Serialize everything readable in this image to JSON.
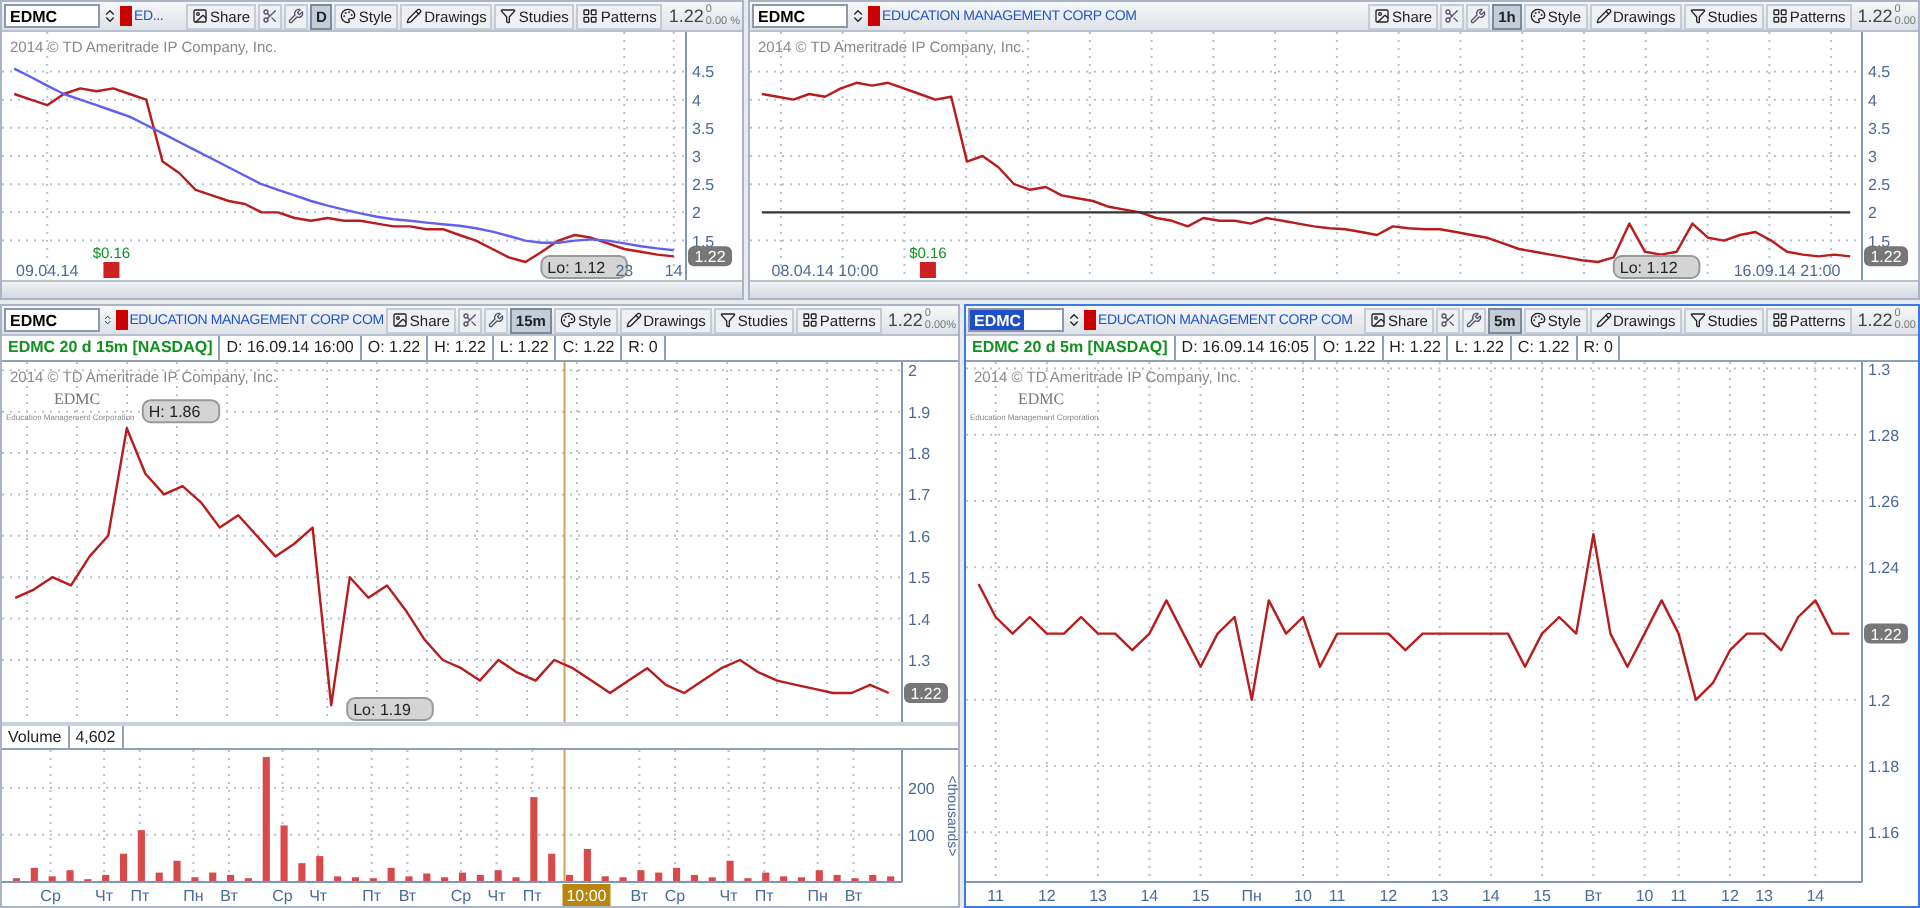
{
  "panels": [
    {
      "active": false,
      "symbol": {
        "value": "EDMC",
        "highlighted": false
      },
      "company": "ED...",
      "interval": "D",
      "price": "1.22",
      "change": "0",
      "change_pct": "0.00 %",
      "buttons": [
        "Share",
        "Style",
        "Drawings",
        "Studies",
        "Patterns"
      ],
      "copyright": "2014 © TD Ameritrade IP Company, Inc.",
      "dividend": "$0.16",
      "last_price_tag": "1.22",
      "chart_data": {
        "type": "line",
        "grid": true,
        "ylim": [
          0.8,
          5.2
        ],
        "yticks": [
          1.5,
          2,
          2.5,
          3,
          3.5,
          4,
          4.5
        ],
        "categories": [
          null,
          null,
          "09.04.14",
          null,
          null,
          null,
          null,
          null,
          null,
          null,
          null,
          null,
          null,
          null,
          null,
          null,
          null,
          null,
          null,
          null,
          null,
          null,
          null,
          null,
          null,
          null,
          null,
          null,
          null,
          null,
          null,
          null,
          null,
          null,
          null,
          null,
          null,
          "23",
          null,
          null,
          "14"
        ],
        "series": [
          {
            "color": "#b81c1c",
            "values": [
              4.1,
              4.0,
              3.9,
              4.1,
              4.2,
              4.15,
              4.2,
              4.1,
              4.0,
              2.9,
              2.7,
              2.4,
              2.3,
              2.2,
              2.15,
              2.0,
              2.0,
              1.9,
              1.85,
              1.9,
              1.85,
              1.85,
              1.8,
              1.75,
              1.75,
              1.7,
              1.7,
              1.6,
              1.5,
              1.35,
              1.2,
              1.12,
              1.3,
              1.5,
              1.6,
              1.55,
              1.45,
              1.35,
              1.3,
              1.25,
              1.22
            ]
          },
          {
            "color": "#6060f0",
            "values": [
              4.55,
              4.4,
              4.25,
              4.1,
              4.0,
              3.9,
              3.8,
              3.7,
              3.55,
              3.4,
              3.25,
              3.1,
              2.95,
              2.8,
              2.65,
              2.5,
              2.4,
              2.3,
              2.2,
              2.12,
              2.05,
              1.98,
              1.92,
              1.88,
              1.85,
              1.82,
              1.79,
              1.76,
              1.72,
              1.66,
              1.58,
              1.5,
              1.46,
              1.46,
              1.5,
              1.52,
              1.5,
              1.45,
              1.4,
              1.36,
              1.33
            ]
          }
        ]
      },
      "callouts": [
        {
          "kind": "low",
          "text": "Lo: 1.12"
        }
      ]
    },
    {
      "active": false,
      "symbol": {
        "value": "EDMC",
        "highlighted": false
      },
      "company": "EDUCATION MANAGEMENT CORP COM",
      "interval": "1h",
      "price": "1.22",
      "change": "0",
      "change_pct": "0.00",
      "buttons": [
        "Share",
        "Style",
        "Drawings",
        "Studies",
        "Patterns"
      ],
      "copyright": "2014 © TD Ameritrade IP Company, Inc.",
      "dividend": "$0.16",
      "last_price_tag": "1.22",
      "chart_data": {
        "type": "line",
        "grid": true,
        "ylim": [
          0.8,
          5.2
        ],
        "yticks": [
          1.5,
          2,
          2.5,
          3,
          3.5,
          4,
          4.5
        ],
        "categories": [
          null,
          null,
          null,
          null,
          "08.04.14 10:00",
          null,
          null,
          null,
          null,
          null,
          null,
          null,
          null,
          null,
          null,
          null,
          null,
          null,
          null,
          null,
          null,
          null,
          null,
          null,
          null,
          null,
          null,
          null,
          null,
          null,
          null,
          null,
          null,
          null,
          null,
          null,
          null,
          null,
          null,
          null,
          null,
          null,
          null,
          null,
          null,
          null,
          null,
          null,
          null,
          null,
          null,
          null,
          null,
          null,
          null,
          null,
          null,
          null,
          null,
          null,
          null,
          null,
          null,
          null,
          null,
          "16.09.14 21:00",
          null,
          null,
          null,
          null
        ],
        "series": [
          {
            "color": "#b81c1c",
            "values": [
              4.1,
              4.05,
              4.0,
              4.1,
              4.05,
              4.2,
              4.3,
              4.25,
              4.3,
              4.2,
              4.1,
              4.0,
              4.05,
              2.9,
              3.0,
              2.8,
              2.5,
              2.4,
              2.45,
              2.3,
              2.25,
              2.2,
              2.1,
              2.05,
              2.0,
              1.9,
              1.85,
              1.75,
              1.9,
              1.85,
              1.85,
              1.8,
              1.9,
              1.85,
              1.8,
              1.75,
              1.72,
              1.7,
              1.65,
              1.6,
              1.75,
              1.72,
              1.7,
              1.7,
              1.65,
              1.6,
              1.55,
              1.45,
              1.35,
              1.3,
              1.25,
              1.2,
              1.15,
              1.12,
              1.2,
              1.8,
              1.3,
              1.25,
              1.3,
              1.8,
              1.55,
              1.5,
              1.6,
              1.65,
              1.5,
              1.3,
              1.25,
              1.22,
              1.25,
              1.22
            ]
          },
          {
            "color": "#333333",
            "values": [
              2,
              2,
              2,
              2,
              2,
              2,
              2,
              2,
              2,
              2,
              2,
              2,
              2,
              2,
              2,
              2,
              2,
              2,
              2,
              2,
              2,
              2,
              2,
              2,
              2,
              2,
              2,
              2,
              2,
              2,
              2,
              2,
              2,
              2,
              2,
              2,
              2,
              2,
              2,
              2,
              2,
              2,
              2,
              2,
              2,
              2,
              2,
              2,
              2,
              2,
              2,
              2,
              2,
              2,
              2,
              2,
              2,
              2,
              2,
              2,
              2,
              2,
              2,
              2,
              2,
              2,
              2,
              2,
              2,
              2
            ]
          }
        ]
      },
      "callouts": [
        {
          "kind": "low",
          "text": "Lo: 1.12"
        }
      ]
    },
    {
      "active": false,
      "symbol": {
        "value": "EDMC",
        "highlighted": false
      },
      "company": "EDUCATION MANAGEMENT CORP COM",
      "interval": "15m",
      "price": "1.22",
      "change": "0",
      "change_pct": "0.00%",
      "buttons": [
        "Share",
        "Style",
        "Drawings",
        "Studies",
        "Patterns"
      ],
      "copyright": "2014 © TD Ameritrade IP Company, Inc.",
      "logo": {
        "title": "EDMC",
        "subtitle": "Education Management Corporation"
      },
      "last_price_tag": "1.22",
      "cursor": {
        "label": "10:00"
      },
      "info": [
        {
          "kind": "symbol",
          "text": "EDMC 20 d 15m [NASDAQ]"
        },
        {
          "kind": "field",
          "text": "D: 16.09.14 16:00"
        },
        {
          "kind": "field",
          "text": "O: 1.22"
        },
        {
          "kind": "field",
          "text": "H: 1.22"
        },
        {
          "kind": "field",
          "text": "L: 1.22"
        },
        {
          "kind": "field",
          "text": "C: 1.22"
        },
        {
          "kind": "field",
          "text": "R: 0"
        }
      ],
      "chart_data": {
        "type": "line",
        "grid": true,
        "ylim": [
          1.15,
          2.02
        ],
        "yticks": [
          1.3,
          1.4,
          1.5,
          1.6,
          1.7,
          1.8,
          1.9,
          2
        ],
        "series": [
          {
            "color": "#b81c1c",
            "values": [
              1.45,
              1.47,
              1.5,
              1.48,
              1.55,
              1.6,
              1.86,
              1.75,
              1.7,
              1.72,
              1.68,
              1.62,
              1.65,
              1.6,
              1.55,
              1.58,
              1.62,
              1.19,
              1.5,
              1.45,
              1.48,
              1.42,
              1.35,
              1.3,
              1.28,
              1.25,
              1.3,
              1.27,
              1.25,
              1.3,
              1.28,
              1.25,
              1.22,
              1.25,
              1.28,
              1.24,
              1.22,
              1.25,
              1.28,
              1.3,
              1.27,
              1.25,
              1.24,
              1.23,
              1.22,
              1.22,
              1.24,
              1.22
            ]
          }
        ]
      },
      "callouts": [
        {
          "kind": "high",
          "text": "H: 1.86"
        },
        {
          "kind": "low",
          "text": "Lo: 1.19"
        }
      ],
      "volume": {
        "label": "Volume",
        "reading": "4,602",
        "unit": "<thousands>",
        "chart_data": {
          "type": "bar",
          "grid": true,
          "ylim": [
            0,
            280
          ],
          "yticks": [
            100,
            200
          ],
          "categories": [
            null,
            null,
            "Ср",
            null,
            null,
            "Чт",
            null,
            "Пт",
            null,
            null,
            "Пн",
            null,
            "Вт",
            null,
            null,
            "Ср",
            null,
            "Чт",
            null,
            null,
            "Пт",
            null,
            "Вт",
            null,
            null,
            "Ср",
            null,
            "Чт",
            null,
            "Пт",
            null,
            null,
            null,
            null,
            null,
            "Вт",
            null,
            "Ср",
            null,
            null,
            "Чт",
            null,
            "Пт",
            null,
            null,
            "Пн",
            null,
            "Вт",
            null,
            null
          ],
          "series": [
            {
              "color": "#d84a4a",
              "values": [
                8,
                30,
                12,
                25,
                6,
                15,
                60,
                110,
                20,
                45,
                10,
                20,
                15,
                8,
                265,
                120,
                40,
                55,
                12,
                10,
                8,
                30,
                12,
                18,
                10,
                20,
                15,
                25,
                10,
                180,
                60,
                15,
                70,
                12,
                10,
                25,
                20,
                30,
                15,
                10,
                45,
                8,
                20,
                12,
                10,
                25,
                15,
                8,
                15,
                12
              ]
            }
          ]
        }
      }
    },
    {
      "active": true,
      "symbol": {
        "value": "EDMC",
        "highlighted": true
      },
      "company": "EDUCATION MANAGEMENT CORP COM",
      "interval": "5m",
      "price": "1.22",
      "change": "0",
      "change_pct": "0.00",
      "buttons": [
        "Share",
        "Style",
        "Drawings",
        "Studies",
        "Patterns"
      ],
      "copyright": "2014 © TD Ameritrade IP Company, Inc.",
      "logo": {
        "title": "EDMC",
        "subtitle": "Education Management Corporation"
      },
      "last_price_tag": "1.22",
      "info": [
        {
          "kind": "symbol",
          "text": "EDMC 20 d 5m [NASDAQ]"
        },
        {
          "kind": "field",
          "text": "D: 16.09.14 16:05"
        },
        {
          "kind": "field",
          "text": "O: 1.22"
        },
        {
          "kind": "field",
          "text": "H: 1.22"
        },
        {
          "kind": "field",
          "text": "L: 1.22"
        },
        {
          "kind": "field",
          "text": "C: 1.22"
        },
        {
          "kind": "field",
          "text": "R: 0"
        }
      ],
      "chart_data": {
        "type": "line",
        "grid": true,
        "ylim": [
          1.145,
          1.302
        ],
        "yticks": [
          1.16,
          1.18,
          1.2,
          1.24,
          1.26,
          1.28,
          1.3
        ],
        "categories": [
          null,
          "11",
          null,
          null,
          "12",
          null,
          null,
          "13",
          null,
          null,
          "14",
          null,
          null,
          "15",
          null,
          null,
          "Пн",
          null,
          null,
          "10",
          null,
          "11",
          null,
          null,
          "12",
          null,
          null,
          "13",
          null,
          null,
          "14",
          null,
          null,
          "15",
          null,
          null,
          "Вт",
          null,
          null,
          "10",
          null,
          "11",
          null,
          null,
          "12",
          null,
          "13",
          null,
          null,
          "14",
          null,
          null
        ],
        "series": [
          {
            "color": "#b81c1c",
            "values": [
              1.235,
              1.225,
              1.22,
              1.225,
              1.22,
              1.22,
              1.225,
              1.22,
              1.22,
              1.215,
              1.22,
              1.23,
              1.22,
              1.21,
              1.22,
              1.225,
              1.2,
              1.23,
              1.22,
              1.225,
              1.21,
              1.22,
              1.22,
              1.22,
              1.22,
              1.215,
              1.22,
              1.22,
              1.22,
              1.22,
              1.22,
              1.22,
              1.21,
              1.22,
              1.225,
              1.22,
              1.25,
              1.22,
              1.21,
              1.22,
              1.23,
              1.22,
              1.2,
              1.205,
              1.215,
              1.22,
              1.22,
              1.215,
              1.225,
              1.23,
              1.22,
              1.22
            ]
          }
        ]
      }
    }
  ]
}
